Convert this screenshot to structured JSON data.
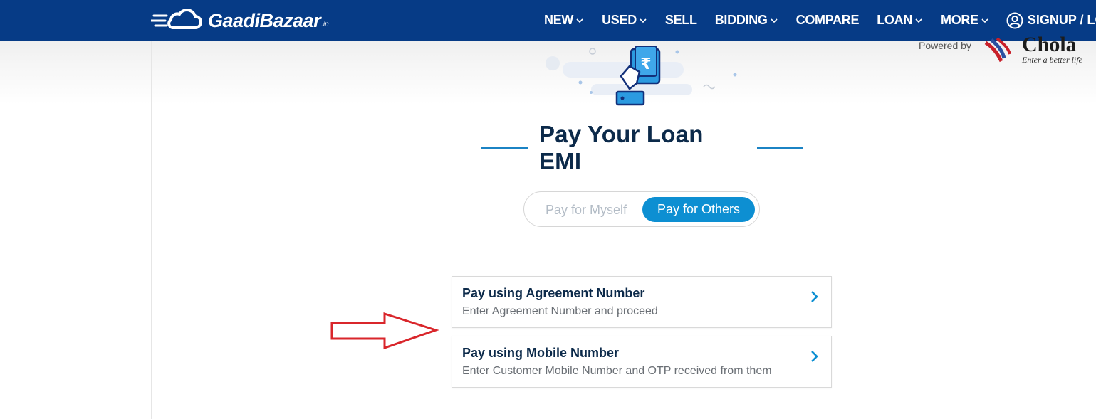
{
  "header": {
    "logo_text": "GaadiBazaar",
    "logo_suffix": ".in",
    "nav": [
      {
        "label": "NEW",
        "dropdown": true
      },
      {
        "label": "USED",
        "dropdown": true
      },
      {
        "label": "SELL",
        "dropdown": false
      },
      {
        "label": "BIDDING",
        "dropdown": true
      },
      {
        "label": "COMPARE",
        "dropdown": false
      },
      {
        "label": "LOAN",
        "dropdown": true
      },
      {
        "label": "MORE",
        "dropdown": true
      }
    ],
    "signup_label": "SIGNUP / LOG"
  },
  "partner": {
    "powered_by": "Powered by",
    "name": "Chola",
    "tagline": "Enter a better life"
  },
  "main": {
    "title": "Pay Your Loan EMI",
    "toggle": {
      "option_myself": "Pay for Myself",
      "option_others": "Pay for Others",
      "selected": "Pay for Others"
    },
    "options": [
      {
        "title": "Pay using Agreement Number",
        "subtitle": "Enter Agreement Number and proceed"
      },
      {
        "title": "Pay using Mobile Number",
        "subtitle": "Enter Customer Mobile Number and OTP received from them"
      }
    ]
  },
  "colors": {
    "header_bg": "#063b86",
    "accent": "#0d8fd2",
    "title": "#0c2a4a",
    "annotation_arrow": "#d9262b"
  },
  "icons": {
    "logo": "cloud-logo-icon",
    "nav_dropdown": "chevron-down-icon",
    "user": "user-circle-icon",
    "illustration": "hand-holding-phone-rupee-icon",
    "card_arrow": "chevron-right-icon",
    "annotation": "red-arrow-icon"
  }
}
